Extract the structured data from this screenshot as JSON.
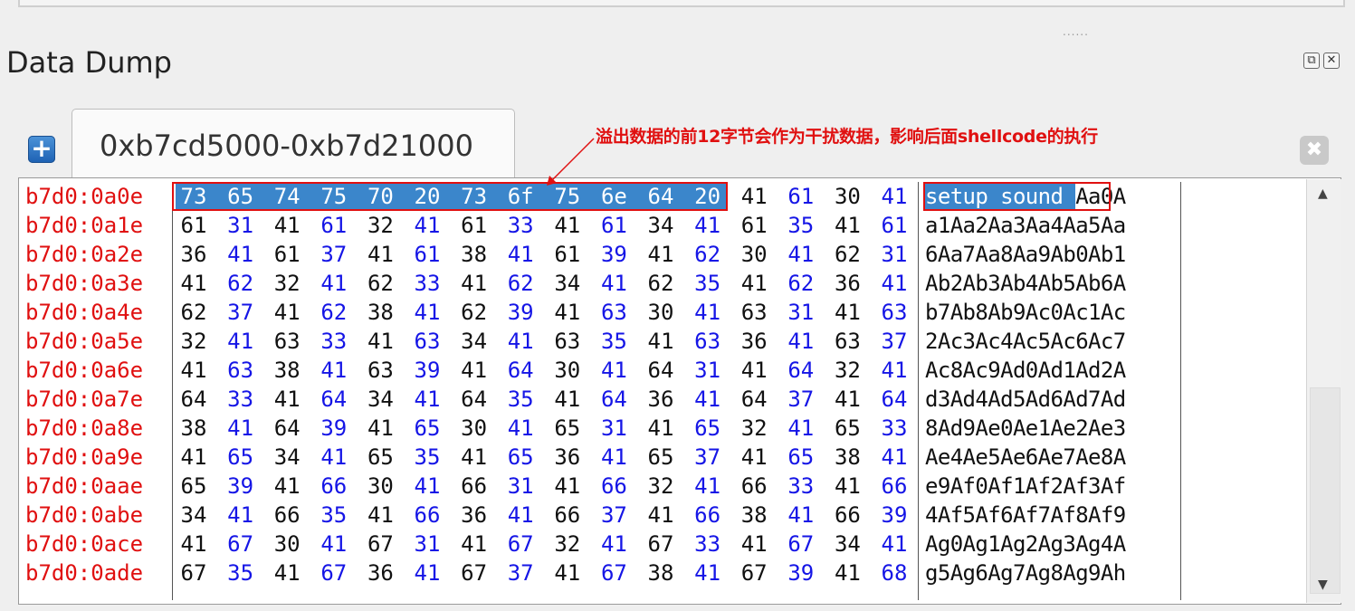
{
  "panel": {
    "title": "Data Dump",
    "restore_icon": "restore-window-icon",
    "close_icon": "close-window-icon"
  },
  "tabs": [
    {
      "label": "0xb7cd5000-0xb7d21000",
      "active": true
    }
  ],
  "tab_controls": {
    "add_icon": "plus-icon",
    "add_glyph": "+",
    "close_icon": "close-tab-icon",
    "close_glyph": "✖"
  },
  "annotation": {
    "text": "溢出数据的前12字节会作为干扰数据，影响后面shellcode的执行",
    "color": "#e01010"
  },
  "colors": {
    "address": "#e01010",
    "byte_alt": "#1515e6",
    "selection": "#3b86cb"
  },
  "dump": {
    "selected_row": 0,
    "selected_bytes": 12,
    "selected_ascii": "setup sound ",
    "rows": [
      {
        "address": "b7d0:0a0e",
        "bytes": [
          "73",
          "65",
          "74",
          "75",
          "70",
          "20",
          "73",
          "6f",
          "75",
          "6e",
          "64",
          "20",
          "41",
          "61",
          "30",
          "41"
        ],
        "ascii": "setup sound Aa0A"
      },
      {
        "address": "b7d0:0a1e",
        "bytes": [
          "61",
          "31",
          "41",
          "61",
          "32",
          "41",
          "61",
          "33",
          "41",
          "61",
          "34",
          "41",
          "61",
          "35",
          "41",
          "61"
        ],
        "ascii": "a1Aa2Aa3Aa4Aa5Aa"
      },
      {
        "address": "b7d0:0a2e",
        "bytes": [
          "36",
          "41",
          "61",
          "37",
          "41",
          "61",
          "38",
          "41",
          "61",
          "39",
          "41",
          "62",
          "30",
          "41",
          "62",
          "31"
        ],
        "ascii": "6Aa7Aa8Aa9Ab0Ab1"
      },
      {
        "address": "b7d0:0a3e",
        "bytes": [
          "41",
          "62",
          "32",
          "41",
          "62",
          "33",
          "41",
          "62",
          "34",
          "41",
          "62",
          "35",
          "41",
          "62",
          "36",
          "41"
        ],
        "ascii": "Ab2Ab3Ab4Ab5Ab6A"
      },
      {
        "address": "b7d0:0a4e",
        "bytes": [
          "62",
          "37",
          "41",
          "62",
          "38",
          "41",
          "62",
          "39",
          "41",
          "63",
          "30",
          "41",
          "63",
          "31",
          "41",
          "63"
        ],
        "ascii": "b7Ab8Ab9Ac0Ac1Ac"
      },
      {
        "address": "b7d0:0a5e",
        "bytes": [
          "32",
          "41",
          "63",
          "33",
          "41",
          "63",
          "34",
          "41",
          "63",
          "35",
          "41",
          "63",
          "36",
          "41",
          "63",
          "37"
        ],
        "ascii": "2Ac3Ac4Ac5Ac6Ac7"
      },
      {
        "address": "b7d0:0a6e",
        "bytes": [
          "41",
          "63",
          "38",
          "41",
          "63",
          "39",
          "41",
          "64",
          "30",
          "41",
          "64",
          "31",
          "41",
          "64",
          "32",
          "41"
        ],
        "ascii": "Ac8Ac9Ad0Ad1Ad2A"
      },
      {
        "address": "b7d0:0a7e",
        "bytes": [
          "64",
          "33",
          "41",
          "64",
          "34",
          "41",
          "64",
          "35",
          "41",
          "64",
          "36",
          "41",
          "64",
          "37",
          "41",
          "64"
        ],
        "ascii": "d3Ad4Ad5Ad6Ad7Ad"
      },
      {
        "address": "b7d0:0a8e",
        "bytes": [
          "38",
          "41",
          "64",
          "39",
          "41",
          "65",
          "30",
          "41",
          "65",
          "31",
          "41",
          "65",
          "32",
          "41",
          "65",
          "33"
        ],
        "ascii": "8Ad9Ae0Ae1Ae2Ae3"
      },
      {
        "address": "b7d0:0a9e",
        "bytes": [
          "41",
          "65",
          "34",
          "41",
          "65",
          "35",
          "41",
          "65",
          "36",
          "41",
          "65",
          "37",
          "41",
          "65",
          "38",
          "41"
        ],
        "ascii": "Ae4Ae5Ae6Ae7Ae8A"
      },
      {
        "address": "b7d0:0aae",
        "bytes": [
          "65",
          "39",
          "41",
          "66",
          "30",
          "41",
          "66",
          "31",
          "41",
          "66",
          "32",
          "41",
          "66",
          "33",
          "41",
          "66"
        ],
        "ascii": "e9Af0Af1Af2Af3Af"
      },
      {
        "address": "b7d0:0abe",
        "bytes": [
          "34",
          "41",
          "66",
          "35",
          "41",
          "66",
          "36",
          "41",
          "66",
          "37",
          "41",
          "66",
          "38",
          "41",
          "66",
          "39"
        ],
        "ascii": "4Af5Af6Af7Af8Af9"
      },
      {
        "address": "b7d0:0ace",
        "bytes": [
          "41",
          "67",
          "30",
          "41",
          "67",
          "31",
          "41",
          "67",
          "32",
          "41",
          "67",
          "33",
          "41",
          "67",
          "34",
          "41"
        ],
        "ascii": "Ag0Ag1Ag2Ag3Ag4A"
      },
      {
        "address": "b7d0:0ade",
        "bytes": [
          "67",
          "35",
          "41",
          "67",
          "36",
          "41",
          "67",
          "37",
          "41",
          "67",
          "38",
          "41",
          "67",
          "39",
          "41",
          "68"
        ],
        "ascii": "g5Ag6Ag7Ag8Ag9Ah"
      }
    ]
  },
  "scrollbar": {
    "up_glyph": "▲",
    "down_glyph": "▼"
  }
}
